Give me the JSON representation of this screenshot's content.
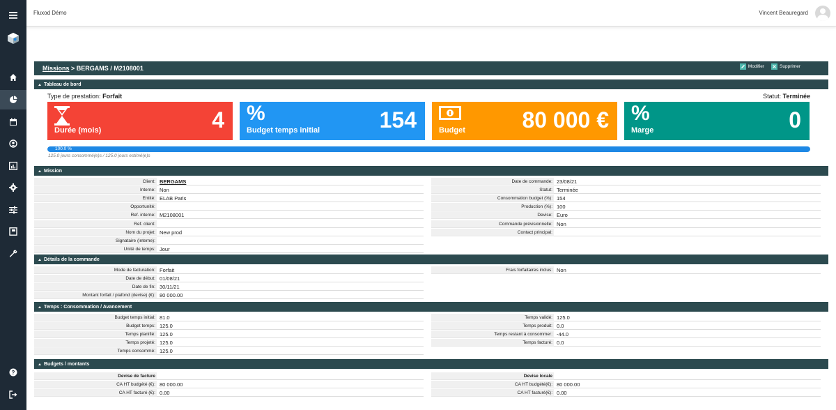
{
  "app": {
    "title": "Fluxod Démo",
    "user": "Vincent Beauregard"
  },
  "sidebar": {
    "items": [
      {
        "icon": "menu-icon"
      },
      {
        "icon": "logo-cube-icon"
      },
      {
        "icon": "home-icon"
      },
      {
        "icon": "chart-pie-icon",
        "active": true
      },
      {
        "icon": "calendar-icon"
      },
      {
        "icon": "user-circle-icon"
      },
      {
        "icon": "bar-chart-icon"
      },
      {
        "icon": "gear-icon"
      },
      {
        "icon": "sliders-icon"
      },
      {
        "icon": "book-icon"
      },
      {
        "icon": "wrench-icon"
      },
      {
        "icon": "help-icon"
      },
      {
        "icon": "logout-icon"
      }
    ]
  },
  "breadcrumb": {
    "root": "Missions",
    "separator": " > ",
    "current": "BERGAMS / M2108001"
  },
  "actions": {
    "edit": "Modifier",
    "delete": "Supprimer"
  },
  "dashboard": {
    "section": "Tableau de bord",
    "type_label": "Type de prestation:",
    "type_value": "Forfait",
    "status_label": "Statut:",
    "status_value": "Terminée",
    "cards": [
      {
        "label": "Durée (mois)",
        "value": "4",
        "color": "#f44336",
        "icon": "hourglass-icon"
      },
      {
        "label": "Budget temps initial",
        "value": "154",
        "color": "#2196f3",
        "icon": "percent-icon"
      },
      {
        "label": "Budget",
        "value": "80 000 €",
        "color": "#ff9800",
        "icon": "banknote-icon"
      },
      {
        "label": "Marge",
        "value": "0",
        "color": "#009688",
        "icon": "percent-icon"
      }
    ],
    "progress": {
      "percent_text": "100.0 %",
      "fraction": 1.0,
      "note": "125.0 jours consommé(e)s / 125.0 jours estimé(e)s"
    }
  },
  "mission": {
    "section": "Mission",
    "left": [
      {
        "k": "Client:",
        "v": "BERGAMS",
        "link": true
      },
      {
        "k": "Interne:",
        "v": "Non"
      },
      {
        "k": "Entité:",
        "v": "ELAB Paris"
      },
      {
        "k": "Opportunité:",
        "v": ""
      },
      {
        "k": "Ref. interne:",
        "v": "M2108001"
      },
      {
        "k": "Ref. client:",
        "v": ""
      },
      {
        "k": "Nom du projet:",
        "v": "New prod"
      },
      {
        "k": "Signataire (interne):",
        "v": ""
      },
      {
        "k": "Unité de temps:",
        "v": "Jour"
      }
    ],
    "right": [
      {
        "k": "Date de commande:",
        "v": "23/08/21"
      },
      {
        "k": "Statut:",
        "v": "Terminée"
      },
      {
        "k": "Consommation budget (%):",
        "v": "154"
      },
      {
        "k": "Production (%):",
        "v": "100"
      },
      {
        "k": "Devise:",
        "v": "Euro"
      },
      {
        "k": "Commande prévisionnelle:",
        "v": "Non"
      },
      {
        "k": "Contact principal:",
        "v": ""
      }
    ]
  },
  "order": {
    "section": "Détails de la commande",
    "left": [
      {
        "k": "Mode de facturation:",
        "v": "Forfait"
      },
      {
        "k": "Date de début:",
        "v": "01/08/21"
      },
      {
        "k": "Date de fin:",
        "v": "30/11/21"
      },
      {
        "k": "Montant forfait / plafond (devise) (€):",
        "v": "80 000.00"
      }
    ],
    "right": [
      {
        "k": "Frais forfaitaires inclus:",
        "v": "Non"
      }
    ]
  },
  "time": {
    "section": "Temps : Consommation / Avancement",
    "left": [
      {
        "k": "Budget temps initial:",
        "v": "81.0"
      },
      {
        "k": "Budget temps:",
        "v": "125.0"
      },
      {
        "k": "Temps planifié:",
        "v": "125.0"
      },
      {
        "k": "Temps projeté:",
        "v": "125.0"
      },
      {
        "k": "Temps consommé:",
        "v": "125.0"
      }
    ],
    "right": [
      {
        "k": "Temps validé:",
        "v": "125.0"
      },
      {
        "k": "Temps produit:",
        "v": "0.0"
      },
      {
        "k": "Temps restant à consommer:",
        "v": "-44.0"
      },
      {
        "k": "Temps facturé:",
        "v": "0.0"
      }
    ]
  },
  "budgets": {
    "section": "Budgets / montants",
    "left": [
      {
        "k": "Devise de facture",
        "v": "",
        "hdr": true
      },
      {
        "k": "CA HT budgété (€):",
        "v": "80 000.00"
      },
      {
        "k": "CA HT facturé (€):",
        "v": "0.00"
      }
    ],
    "right": [
      {
        "k": "Devise locale",
        "v": "",
        "hdr": true
      },
      {
        "k": "CA HT budgété(€):",
        "v": "80 000.00"
      },
      {
        "k": "CA HT facturé(€):",
        "v": "0.00"
      }
    ]
  }
}
